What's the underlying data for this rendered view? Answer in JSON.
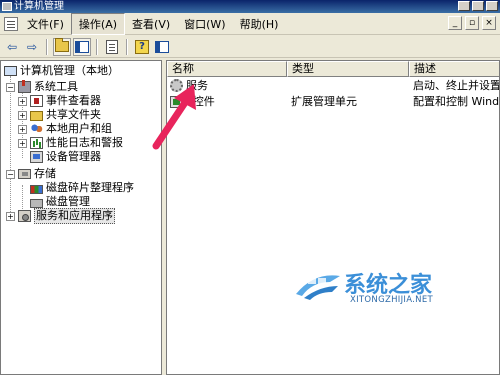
{
  "window": {
    "title": "计算机管理"
  },
  "menu": {
    "items": [
      "文件(F)",
      "操作(A)",
      "查看(V)",
      "窗口(W)",
      "帮助(H)"
    ],
    "active_index": 1
  },
  "toolbar": {
    "buttons": [
      "back-arrow-icon",
      "forward-arrow-icon",
      "up-folder-icon",
      "show-hide-tree-icon",
      "properties-icon",
      "help-icon",
      "console-tree-icon"
    ]
  },
  "tree": {
    "items": [
      {
        "label": "计算机管理（本地）",
        "icon": "computer-icon",
        "level": 0,
        "expander": ""
      },
      {
        "label": "系统工具",
        "icon": "tools-icon",
        "level": 1,
        "expander": "−"
      },
      {
        "label": "事件查看器",
        "icon": "event-viewer-icon",
        "level": 2,
        "expander": "+"
      },
      {
        "label": "共享文件夹",
        "icon": "shared-folder-icon",
        "level": 2,
        "expander": "+"
      },
      {
        "label": "本地用户和组",
        "icon": "users-icon",
        "level": 2,
        "expander": "+"
      },
      {
        "label": "性能日志和警报",
        "icon": "performance-icon",
        "level": 2,
        "expander": "+"
      },
      {
        "label": "设备管理器",
        "icon": "device-manager-icon",
        "level": 2,
        "expander": ""
      },
      {
        "label": "存储",
        "icon": "storage-icon",
        "level": 1,
        "expander": "−"
      },
      {
        "label": "磁盘碎片整理程序",
        "icon": "defrag-icon",
        "level": 2,
        "expander": ""
      },
      {
        "label": "磁盘管理",
        "icon": "disk-icon",
        "level": 2,
        "expander": ""
      },
      {
        "label": "服务和应用程序",
        "icon": "services-icon",
        "level": 1,
        "expander": "+",
        "selected": true
      }
    ]
  },
  "list": {
    "columns": [
      "名称",
      "类型",
      "描述"
    ],
    "rows": [
      {
        "name": "服务",
        "type": "",
        "description": "启动、终止并设置 W",
        "icon": "gear-icon"
      },
      {
        "name": "I 控件",
        "type": "扩展管理单元",
        "description": "配置和控制 Windows",
        "icon": "wmi-icon"
      }
    ]
  },
  "annotation": {
    "arrow_color": "#e8245c"
  },
  "watermark": {
    "title": "系统之家",
    "subtitle": "XITONGZHIJIA.NET"
  }
}
